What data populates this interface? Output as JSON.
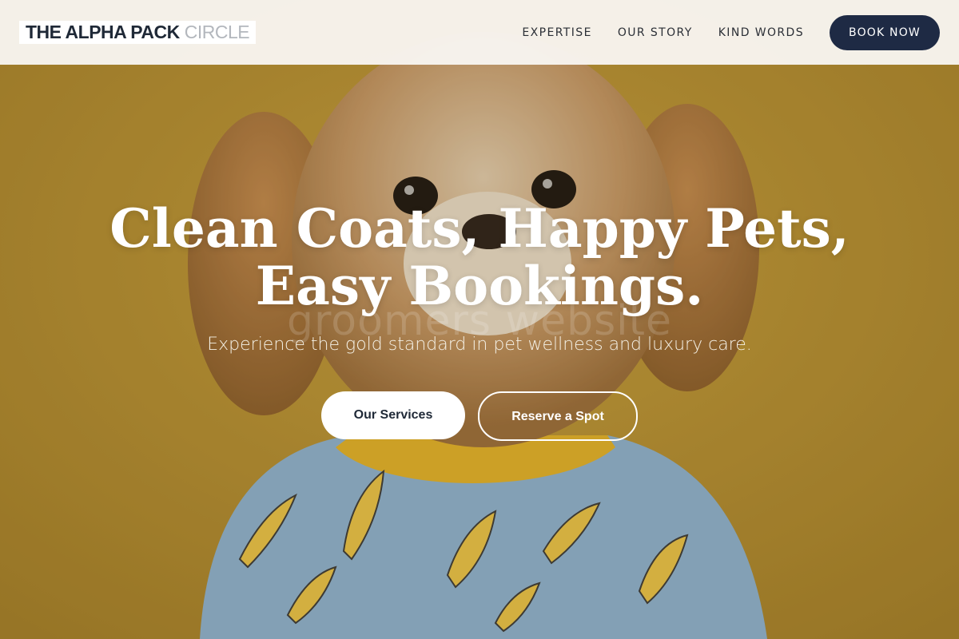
{
  "header": {
    "logo_main": "THE ALPHA PACK",
    "logo_sub": "CIRCLE",
    "nav": [
      {
        "label": "EXPERTISE"
      },
      {
        "label": "OUR STORY"
      },
      {
        "label": "KIND WORDS"
      }
    ],
    "book_label": "BOOK NOW"
  },
  "hero": {
    "headline_line1": "Clean Coats, Happy Pets,",
    "headline_line2": "Easy Bookings.",
    "watermark": "groomers website",
    "subtitle": "Experience the gold standard in pet wellness and luxury care.",
    "primary_cta": "Our Services",
    "secondary_cta": "Reserve a Spot",
    "image": "photo of fluffy dog wearing blue banana-print shirt on mustard background"
  },
  "colors": {
    "background": "#b8902e",
    "header_bg": "#f8f5f0",
    "book_button": "#1e2a44",
    "text_dark": "#1f2937"
  }
}
